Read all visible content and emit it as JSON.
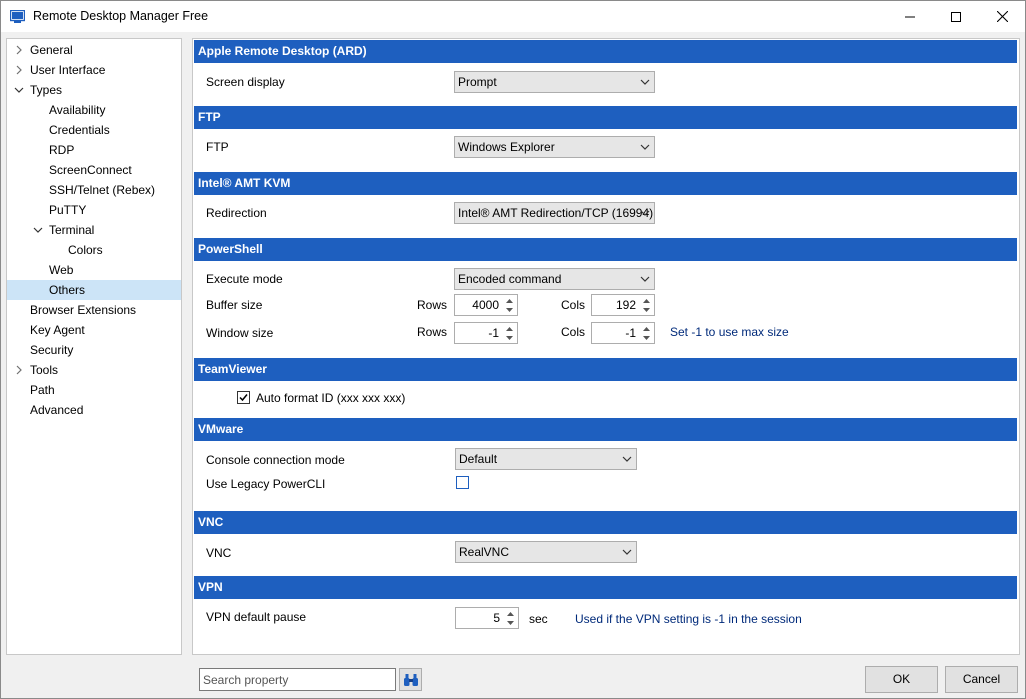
{
  "window": {
    "title": "Remote Desktop Manager Free"
  },
  "sidebar": {
    "items": [
      {
        "label": "General",
        "chevron": "right"
      },
      {
        "label": "User Interface",
        "chevron": "right"
      },
      {
        "label": "Types",
        "chevron": "down"
      },
      {
        "label": "Availability"
      },
      {
        "label": "Credentials"
      },
      {
        "label": "RDP"
      },
      {
        "label": "ScreenConnect"
      },
      {
        "label": "SSH/Telnet (Rebex)"
      },
      {
        "label": "PuTTY"
      },
      {
        "label": "Terminal",
        "chevron": "down"
      },
      {
        "label": "Colors"
      },
      {
        "label": "Web"
      },
      {
        "label": "Others",
        "selected": true
      },
      {
        "label": "Browser Extensions"
      },
      {
        "label": "Key Agent"
      },
      {
        "label": "Security"
      },
      {
        "label": "Tools",
        "chevron": "right"
      },
      {
        "label": "Path"
      },
      {
        "label": "Advanced"
      }
    ]
  },
  "sections": {
    "ard": {
      "title": "Apple Remote Desktop (ARD)",
      "screen_display_label": "Screen display",
      "screen_display_value": "Prompt"
    },
    "ftp": {
      "title": "FTP",
      "ftp_label": "FTP",
      "ftp_value": "Windows Explorer"
    },
    "amt": {
      "title": "Intel® AMT KVM",
      "redirection_label": "Redirection",
      "redirection_value": "Intel® AMT Redirection/TCP (16994)"
    },
    "powershell": {
      "title": "PowerShell",
      "execute_mode_label": "Execute mode",
      "execute_mode_value": "Encoded command",
      "buffer_size_label": "Buffer size",
      "window_size_label": "Window size",
      "rows_label": "Rows",
      "cols_label": "Cols",
      "buffer_rows": "4000",
      "buffer_cols": "192",
      "window_rows": "-1",
      "window_cols": "-1",
      "window_hint": "Set -1 to use max size"
    },
    "teamviewer": {
      "title": "TeamViewer",
      "auto_format_label": "Auto format ID (xxx xxx xxx)",
      "auto_format_checked": true
    },
    "vmware": {
      "title": "VMware",
      "console_mode_label": "Console connection mode",
      "console_mode_value": "Default",
      "legacy_label": "Use Legacy PowerCLI",
      "legacy_checked": false
    },
    "vnc": {
      "title": "VNC",
      "vnc_label": "VNC",
      "vnc_value": "RealVNC"
    },
    "vpn": {
      "title": "VPN",
      "pause_label": "VPN default pause",
      "pause_value": "5",
      "pause_unit": "sec",
      "pause_hint": "Used if the VPN setting is -1 in the session"
    }
  },
  "footer": {
    "search_placeholder": "Search property",
    "ok_label": "OK",
    "cancel_label": "Cancel"
  },
  "colors": {
    "section_header": "#1e5fbf",
    "selection": "#cce4f7",
    "hint_text": "#002a7a"
  }
}
